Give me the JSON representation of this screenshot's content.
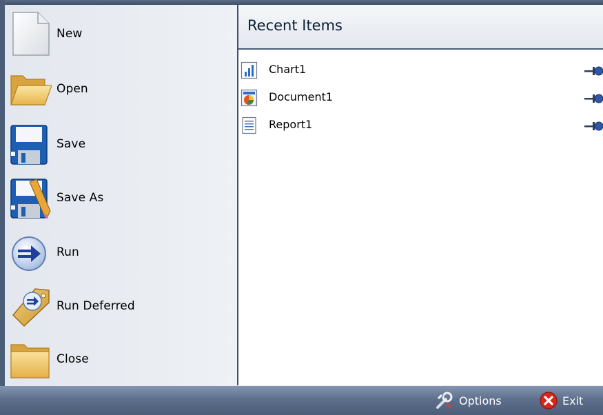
{
  "commands": [
    {
      "label": "New",
      "icon": "new-document-icon"
    },
    {
      "label": "Open",
      "icon": "open-folder-icon"
    },
    {
      "label": "Save",
      "icon": "floppy-disk-icon"
    },
    {
      "label": "Save As",
      "icon": "floppy-disk-pencil-icon"
    },
    {
      "label": "Run",
      "icon": "run-arrow-icon"
    },
    {
      "label": "Run Deferred",
      "icon": "run-deferred-tag-icon"
    },
    {
      "label": "Close",
      "icon": "closed-folder-icon"
    }
  ],
  "recent": {
    "title": "Recent Items",
    "items": [
      {
        "label": "Chart1",
        "icon": "chart-file-icon"
      },
      {
        "label": "Document1",
        "icon": "document-file-icon"
      },
      {
        "label": "Report1",
        "icon": "report-file-icon"
      }
    ]
  },
  "footer": {
    "options_label": "Options",
    "exit_label": "Exit"
  },
  "colors": {
    "frame": "#4b5d77",
    "left_pane": "#e7ebf1",
    "bottom_bar": "#5d6f8c",
    "exit_red": "#d9261c"
  }
}
